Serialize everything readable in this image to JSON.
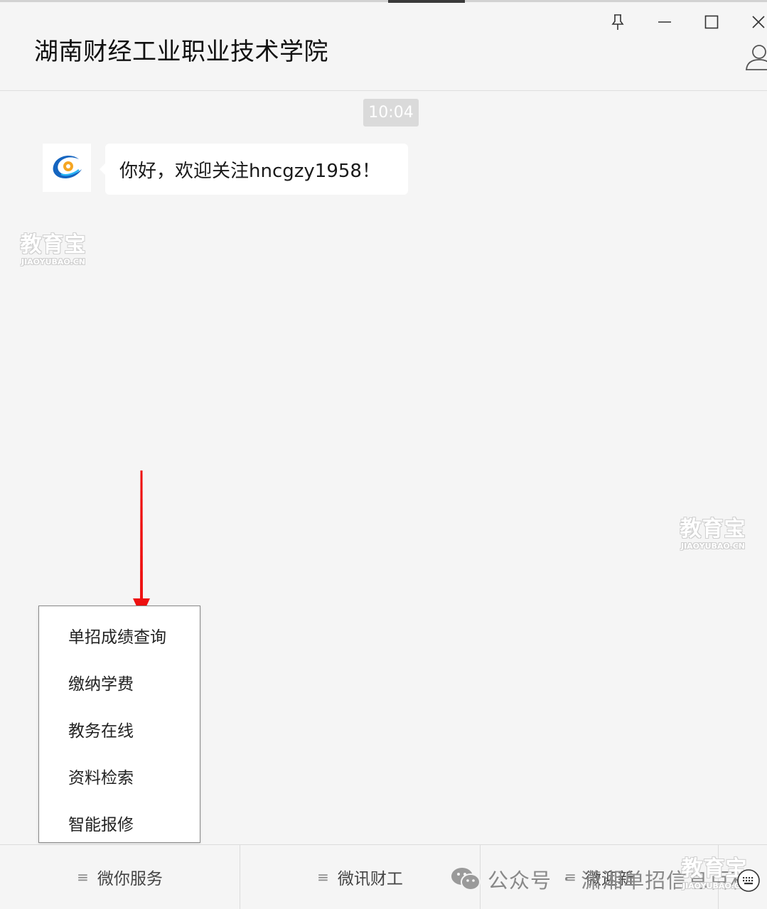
{
  "window": {
    "title": "湖南财经工业职业技术学院",
    "controls": {
      "pin": "pin-icon",
      "minimize": "minimize-icon",
      "maximize": "maximize-icon",
      "close": "close-icon",
      "profile": "profile-icon"
    }
  },
  "chat": {
    "timestamp": "10:04",
    "messages": [
      {
        "sender_avatar": "college-logo-icon",
        "text": "你好，欢迎关注hncgzy1958！"
      }
    ]
  },
  "submenu": {
    "items": [
      "单招成绩查询",
      "缴纳学费",
      "教务在线",
      "资料检索",
      "智能报修"
    ]
  },
  "menu_bar": {
    "tabs": [
      {
        "label": "微你服务"
      },
      {
        "label": "微讯财工"
      },
      {
        "label": "微迎新"
      }
    ],
    "keyboard_icon": "keyboard-icon"
  },
  "overlays": {
    "watermark_text": "教育宝",
    "watermark_url": "JIAOYUBAO.CN",
    "credit": {
      "label": "公众号",
      "separator": "·",
      "name": "潇湘单招信息百科"
    },
    "arrow_color": "#ee1111"
  },
  "colors": {
    "background": "#f5f5f5",
    "bubble": "#ffffff",
    "timestamp_bg": "#dadada",
    "logo_blue": "#1565c0",
    "logo_orange": "#f5a623"
  }
}
